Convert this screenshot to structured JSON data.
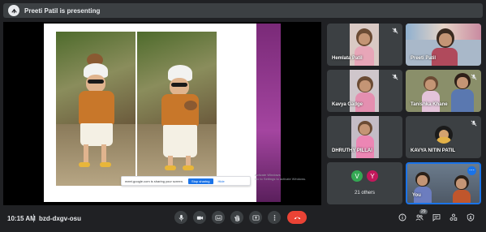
{
  "presenter_bar": {
    "text": "Preeti Patil is presenting"
  },
  "share_banner": {
    "text": "meet.google.com is sharing your screen.",
    "stop_label": "Stop sharing",
    "hide_label": "Hide"
  },
  "watermark": {
    "line1": "Activate Windows",
    "line2": "Go to Settings to activate Windows."
  },
  "tiles": [
    {
      "name": "Hemlata Patil",
      "muted": true
    },
    {
      "name": "Preeti Patil",
      "muted": false
    },
    {
      "name": "Kavya Gadge",
      "muted": true
    },
    {
      "name": "Tanishka Khane",
      "muted": true
    },
    {
      "name": "DHRUTHY PILLAI",
      "muted": false
    },
    {
      "name": "KAVYA NITIN PATIL",
      "muted": true
    }
  ],
  "others": {
    "avatars": [
      "V",
      "Y"
    ],
    "label": "21 others",
    "colors": [
      "#34a853",
      "#c2185b"
    ]
  },
  "self_tile": {
    "name": "You"
  },
  "bottom": {
    "time": "10:15 AM",
    "meeting_code": "bzd-dxgv-osu",
    "participants_count": "29"
  },
  "colors": {
    "accent": "#1a73e8",
    "end_call": "#ea4335",
    "bg": "#202124"
  }
}
